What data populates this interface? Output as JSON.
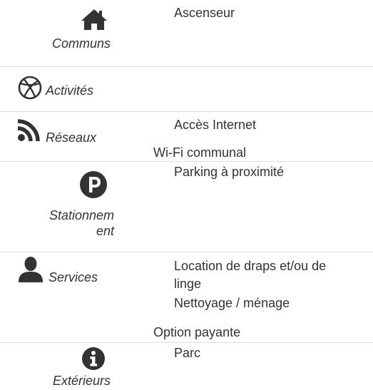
{
  "colors": {
    "text": "#333333",
    "icon": "#333333",
    "divider": "#dcdcdc"
  },
  "sections": [
    {
      "category": "Communs",
      "icon": "home-icon",
      "items": [
        "Ascenseur"
      ]
    },
    {
      "category": "Activités",
      "icon": "basketball-icon",
      "items": []
    },
    {
      "category": "Réseaux",
      "icon": "rss-icon",
      "items": [
        "Accès Internet"
      ],
      "note": "Wi-Fi communal"
    },
    {
      "category_line1": "Stationnem",
      "category_line2": "ent",
      "icon": "parking-icon",
      "items": [
        "Parking à proximité"
      ]
    },
    {
      "category": "Services",
      "icon": "user-icon",
      "items": [
        "Location de draps et/ou de",
        "linge",
        "Nettoyage / ménage"
      ],
      "note": "Option payante"
    },
    {
      "category": "Extérieurs",
      "icon": "info-icon",
      "items": [
        "Parc"
      ]
    }
  ]
}
